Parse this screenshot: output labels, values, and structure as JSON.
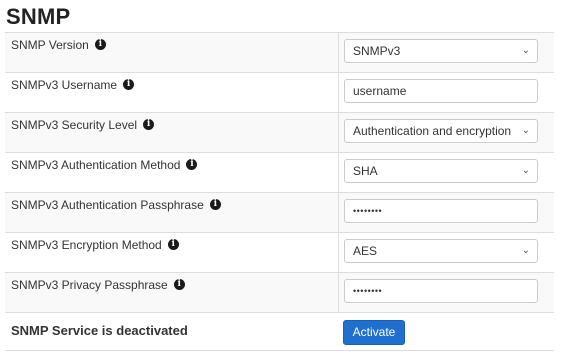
{
  "page": {
    "title": "SNMP"
  },
  "fields": [
    {
      "label": "SNMP Version",
      "type": "select",
      "value": "SNMPv3"
    },
    {
      "label": "SNMPv3 Username",
      "type": "input",
      "value": "username"
    },
    {
      "label": "SNMPv3 Security Level",
      "type": "select",
      "value": "Authentication and encryption"
    },
    {
      "label": "SNMPv3 Authentication Method",
      "type": "select",
      "value": "SHA"
    },
    {
      "label": "SNMPv3 Authentication Passphrase",
      "type": "password",
      "value": "••••••••"
    },
    {
      "label": "SNMPv3 Encryption Method",
      "type": "select",
      "value": "AES"
    },
    {
      "label": "SNMPv3 Privacy Passphrase",
      "type": "password",
      "value": "••••••••"
    }
  ],
  "service": {
    "status_text": "SNMP Service is deactivated",
    "button_label": "Activate"
  },
  "icons": {
    "info": "info-icon",
    "dropdown": "chevron-down-icon"
  },
  "colors": {
    "button_bg": "#1f6fcf",
    "row_shade": "#f9f9f9",
    "border": "#dddddd"
  }
}
